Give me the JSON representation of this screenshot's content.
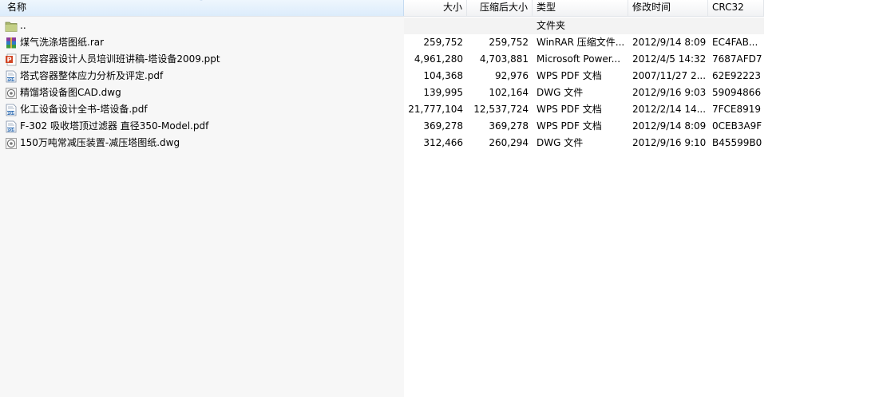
{
  "columns": {
    "name": "名称",
    "size": "大小",
    "packed": "压缩后大小",
    "type": "类型",
    "modified": "修改时间",
    "crc": "CRC32"
  },
  "parent": {
    "name": "..",
    "type": "文件夹",
    "icon": "folder-icon"
  },
  "files": [
    {
      "name": "煤气洗涤塔图纸.rar",
      "size": "259,752",
      "packed": "259,752",
      "type": "WinRAR 压缩文件...",
      "modified": "2012/9/14 8:09",
      "crc": "EC4FAB...",
      "icon": "rar-icon"
    },
    {
      "name": "压力容器设计人员培训班讲稿-塔设备2009.ppt",
      "size": "4,961,280",
      "packed": "4,703,881",
      "type": "Microsoft Power...",
      "modified": "2012/4/5 14:32",
      "crc": "7687AFD7",
      "icon": "ppt-icon"
    },
    {
      "name": "塔式容器整体应力分析及评定.pdf",
      "size": "104,368",
      "packed": "92,976",
      "type": "WPS PDF 文档",
      "modified": "2007/11/27 2...",
      "crc": "62E92223",
      "icon": "pdf-icon"
    },
    {
      "name": "精馏塔设备图CAD.dwg",
      "size": "139,995",
      "packed": "102,164",
      "type": "DWG 文件",
      "modified": "2012/9/16 9:03",
      "crc": "59094866",
      "icon": "dwg-icon"
    },
    {
      "name": "化工设备设计全书-塔设备.pdf",
      "size": "21,777,104",
      "packed": "12,537,724",
      "type": "WPS PDF 文档",
      "modified": "2012/2/14 14...",
      "crc": "7FCE8919",
      "icon": "pdf-icon"
    },
    {
      "name": "F-302 吸收塔顶过滤器 直径350-Model.pdf",
      "size": "369,278",
      "packed": "369,278",
      "type": "WPS PDF 文档",
      "modified": "2012/9/14 8:09",
      "crc": "0CEB3A9F",
      "icon": "pdf-icon"
    },
    {
      "name": "150万吨常减压装置-减压塔图纸.dwg",
      "size": "312,466",
      "packed": "260,294",
      "type": "DWG 文件",
      "modified": "2012/9/16 9:10",
      "crc": "B45599B0",
      "icon": "dwg-icon"
    }
  ],
  "colors": {
    "sorted_column_bg": "#f7f7f7",
    "header_sorted_bg": "#dcecfb",
    "grid_line": "#e3e6ea"
  }
}
